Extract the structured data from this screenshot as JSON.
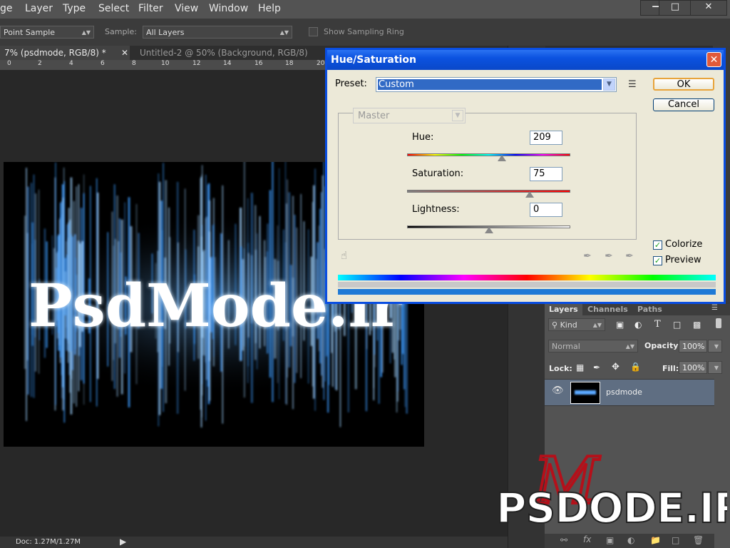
{
  "menu": [
    "ge",
    "Layer",
    "Type",
    "Select",
    "Filter",
    "View",
    "Window",
    "Help"
  ],
  "window_buttons": [
    "—",
    "□",
    "✕"
  ],
  "options": {
    "sample_size": "Point Sample",
    "sample_label": "Sample:",
    "sample_value": "All Layers",
    "sampling_ring": "Show Sampling Ring"
  },
  "tabs": {
    "active": "7% (psdmode, RGB/8) *",
    "inactive": "Untitled-2 @ 50% (Background, RGB/8)"
  },
  "ruler_ticks": [
    "0",
    "2",
    "4",
    "6",
    "8",
    "10",
    "12",
    "14",
    "16",
    "18",
    "20"
  ],
  "canvas_text": "PsdMode.ir",
  "status": {
    "doc": "Doc: 1.27M/1.27M"
  },
  "dialog": {
    "title": "Hue/Saturation",
    "preset_label": "Preset:",
    "preset_value": "Custom",
    "ok": "OK",
    "cancel": "Cancel",
    "channel": "Master",
    "hue_label": "Hue:",
    "hue_value": "209",
    "saturation_label": "Saturation:",
    "saturation_value": "75",
    "lightness_label": "Lightness:",
    "lightness_value": "0",
    "colorize_label": "Colorize",
    "colorize_checked": true,
    "preview_label": "Preview",
    "preview_checked": true,
    "hue_level": 0.58,
    "saturation_level": 0.75,
    "lightness_level": 0.5
  },
  "layers": {
    "tabs": [
      "Layers",
      "Channels",
      "Paths"
    ],
    "kind": "Kind",
    "blend_mode": "Normal",
    "opacity_label": "Opacity:",
    "opacity_value": "100%",
    "lock_label": "Lock:",
    "fill_label": "Fill:",
    "fill_value": "100%",
    "layer_name": "psdmode"
  },
  "watermark": "PSDODE.IR",
  "colors": {
    "title_blue": "#0a52e0",
    "accent": "#316ac5",
    "watermark_red": "#c0111a"
  }
}
